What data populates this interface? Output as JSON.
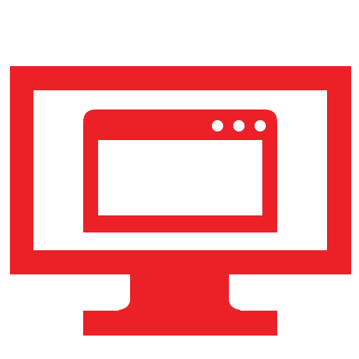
{
  "icon": {
    "name": "monitor-with-browser-window-icon",
    "parts": [
      "monitor-icon",
      "browser-window-icon",
      "window-control-dots-icon"
    ]
  },
  "colors": {
    "accent": "#ec2027",
    "background": "#ffffff"
  }
}
